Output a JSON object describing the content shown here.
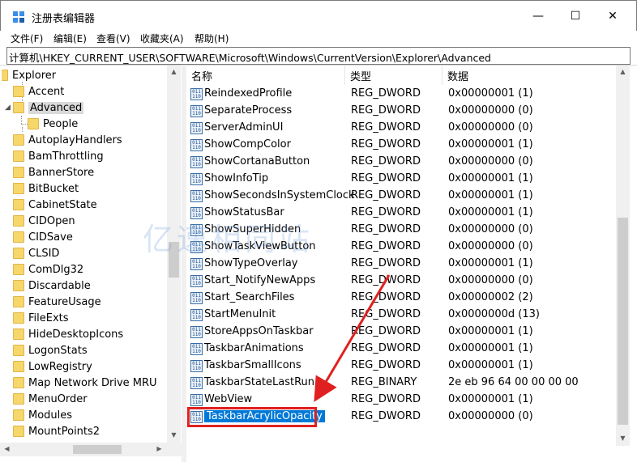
{
  "window": {
    "title": "注册表编辑器",
    "min_glyph": "—",
    "max_glyph": "☐",
    "close_glyph": "✕"
  },
  "menu": [
    "文件(F)",
    "编辑(E)",
    "查看(V)",
    "收藏夹(A)",
    "帮助(H)"
  ],
  "address": "计算机\\HKEY_CURRENT_USER\\SOFTWARE\\Microsoft\\Windows\\CurrentVersion\\Explorer\\Advanced",
  "tree": {
    "items": [
      "Explorer",
      "Accent",
      "Advanced",
      "People",
      "AutoplayHandlers",
      "BamThrottling",
      "BannerStore",
      "BitBucket",
      "CabinetState",
      "CIDOpen",
      "CIDSave",
      "CLSID",
      "ComDlg32",
      "Discardable",
      "FeatureUsage",
      "FileExts",
      "HideDesktopIcons",
      "LogonStats",
      "LowRegistry",
      "Map Network Drive MRU",
      "MenuOrder",
      "Modules",
      "MountPoints2"
    ],
    "selected": "Advanced"
  },
  "list": {
    "columns": [
      "名称",
      "类型",
      "数据"
    ],
    "rows": [
      {
        "name": "ReindexedProfile",
        "type": "REG_DWORD",
        "data": "0x00000001 (1)"
      },
      {
        "name": "SeparateProcess",
        "type": "REG_DWORD",
        "data": "0x00000000 (0)"
      },
      {
        "name": "ServerAdminUI",
        "type": "REG_DWORD",
        "data": "0x00000000 (0)"
      },
      {
        "name": "ShowCompColor",
        "type": "REG_DWORD",
        "data": "0x00000001 (1)"
      },
      {
        "name": "ShowCortanaButton",
        "type": "REG_DWORD",
        "data": "0x00000000 (0)"
      },
      {
        "name": "ShowInfoTip",
        "type": "REG_DWORD",
        "data": "0x00000001 (1)"
      },
      {
        "name": "ShowSecondsInSystemClock",
        "type": "REG_DWORD",
        "data": "0x00000001 (1)"
      },
      {
        "name": "ShowStatusBar",
        "type": "REG_DWORD",
        "data": "0x00000001 (1)"
      },
      {
        "name": "ShowSuperHidden",
        "type": "REG_DWORD",
        "data": "0x00000000 (0)"
      },
      {
        "name": "ShowTaskViewButton",
        "type": "REG_DWORD",
        "data": "0x00000000 (0)"
      },
      {
        "name": "ShowTypeOverlay",
        "type": "REG_DWORD",
        "data": "0x00000001 (1)"
      },
      {
        "name": "Start_NotifyNewApps",
        "type": "REG_DWORD",
        "data": "0x00000000 (0)"
      },
      {
        "name": "Start_SearchFiles",
        "type": "REG_DWORD",
        "data": "0x00000002 (2)"
      },
      {
        "name": "StartMenuInit",
        "type": "REG_DWORD",
        "data": "0x0000000d (13)"
      },
      {
        "name": "StoreAppsOnTaskbar",
        "type": "REG_DWORD",
        "data": "0x00000001 (1)"
      },
      {
        "name": "TaskbarAnimations",
        "type": "REG_DWORD",
        "data": "0x00000001 (1)"
      },
      {
        "name": "TaskbarSmallIcons",
        "type": "REG_DWORD",
        "data": "0x00000001 (1)"
      },
      {
        "name": "TaskbarStateLastRun",
        "type": "REG_BINARY",
        "data": "2e eb 96 64 00 00 00 00"
      },
      {
        "name": "WebView",
        "type": "REG_DWORD",
        "data": "0x00000001 (1)"
      },
      {
        "name": "TaskbarAcrylicOpacity",
        "type": "REG_DWORD",
        "data": "0x00000000 (0)"
      }
    ],
    "highlighted": "TaskbarAcrylicOpacity"
  },
  "watermark": "亿速相同站",
  "colors": {
    "selection": "#0078d7",
    "annotation": "#e02020"
  }
}
